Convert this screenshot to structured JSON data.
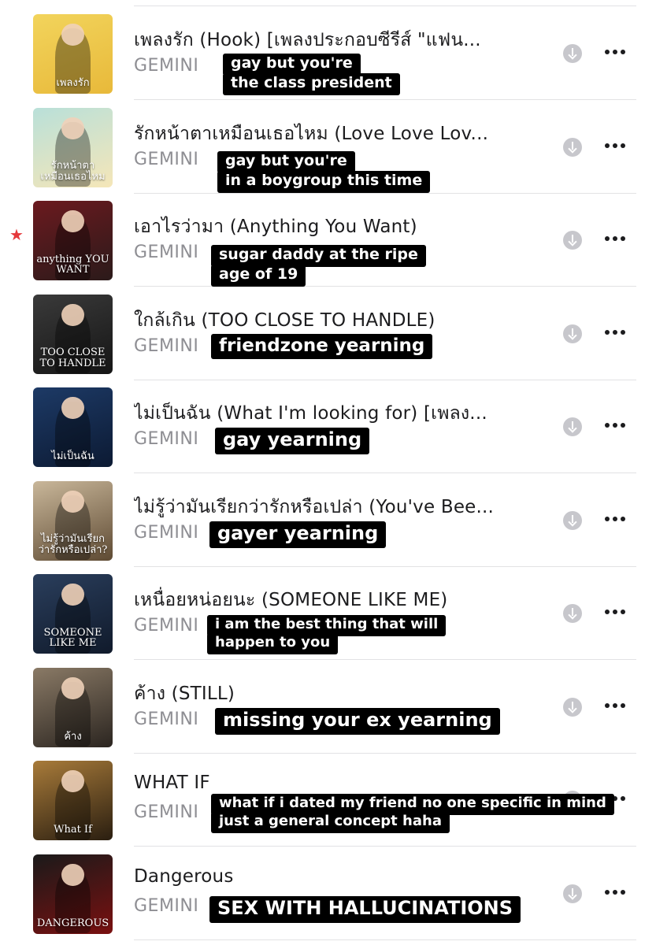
{
  "tracks": [
    {
      "title": "เพลงรัก (Hook) [เพลงประกอบซีรีส์ \"แฟน...",
      "artist": "GEMINI",
      "art_text": "เพลงรัก",
      "captions": [
        "gay but you're",
        "the class president"
      ],
      "art_colors": [
        "#f2d45c",
        "#e8b93a"
      ],
      "favorite": false
    },
    {
      "title": "รักหน้าตาเหมือนเธอไหม (Love Love Lov...",
      "artist": "GEMINI",
      "art_text": "รักหน้าตาเหมือนเธอไหม",
      "captions": [
        "gay but you're",
        "in a boygroup this time"
      ],
      "art_colors": [
        "#b9e0d9",
        "#f5e6b8"
      ],
      "favorite": false
    },
    {
      "title": "เอาไรว่ามา (Anything You Want)",
      "artist": "GEMINI",
      "art_text": "anything YOU WANT",
      "captions": [
        "sugar daddy at the ripe",
        "age of 19"
      ],
      "art_colors": [
        "#6b1a1f",
        "#2b1a1a"
      ],
      "favorite": true
    },
    {
      "title": "ใกล้เกิน (TOO CLOSE TO HANDLE)",
      "artist": "GEMINI",
      "art_text": "TOO CLOSE TO HANDLE",
      "captions": [
        "friendzone yearning"
      ],
      "art_colors": [
        "#3a3a3a",
        "#151515"
      ],
      "favorite": false
    },
    {
      "title": "ไม่เป็นฉัน (What I'm looking for) [เพลง...",
      "artist": "GEMINI",
      "art_text": "ไม่เป็นฉัน",
      "captions": [
        "gay yearning"
      ],
      "art_colors": [
        "#1d3a66",
        "#0c1a33"
      ],
      "favorite": false
    },
    {
      "title": "ไม่รู้ว่ามันเรียกว่ารักหรือเปล่า (You've Bee...",
      "artist": "GEMINI",
      "art_text": "ไม่รู้ว่ามันเรียกว่ารักหรือเปล่า?",
      "captions": [
        "gayer yearning"
      ],
      "art_colors": [
        "#c9b79a",
        "#5e4a33"
      ],
      "favorite": false
    },
    {
      "title": "เหนื่อยหน่อยนะ (SOMEONE LIKE ME)",
      "artist": "GEMINI",
      "art_text": "SOMEONE LIKE ME",
      "captions": [
        "i am the best thing that will",
        "happen to you"
      ],
      "art_colors": [
        "#2a3e5c",
        "#101a2b"
      ],
      "favorite": false
    },
    {
      "title": "ค้าง (STILL)",
      "artist": "GEMINI",
      "art_text": "ค้าง",
      "captions": [
        "missing your ex yearning"
      ],
      "art_colors": [
        "#8a7a66",
        "#2b2520"
      ],
      "favorite": false
    },
    {
      "title": "WHAT IF",
      "artist": "GEMINI",
      "art_text": "What If",
      "captions": [
        "what if i dated my friend no one specific in mind",
        "just a general concept haha"
      ],
      "art_colors": [
        "#a87b3a",
        "#2a1e10"
      ],
      "favorite": false
    },
    {
      "title": "Dangerous",
      "artist": "GEMINI",
      "art_text": "DANGEROUS",
      "captions": [
        "SEX WITH HALLUCINATIONS"
      ],
      "art_colors": [
        "#1a1a1a",
        "#7a1010"
      ],
      "favorite": false
    }
  ],
  "icons": {
    "download": "download-circle-icon",
    "more": "more-ellipsis-icon",
    "favorite": "star-icon"
  },
  "colors": {
    "title": "#1c1c1e",
    "artist": "#8e8e93",
    "favorite_star": "#e5383b",
    "caption_bg": "#000000",
    "caption_text": "#ffffff"
  }
}
